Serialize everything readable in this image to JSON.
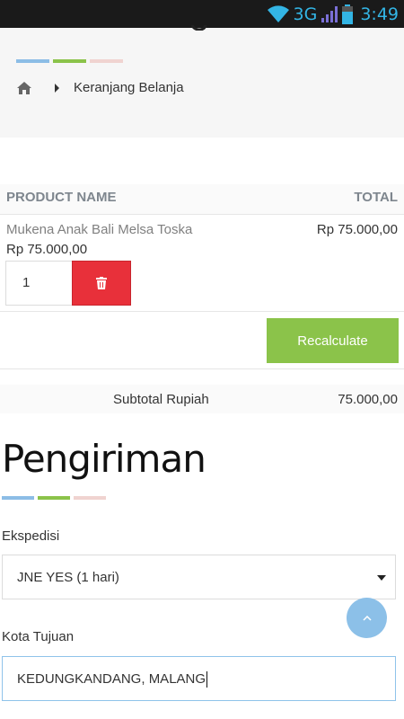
{
  "status_bar": {
    "network": "3G",
    "time": "3:49"
  },
  "breadcrumb": {
    "current": "Keranjang Belanja"
  },
  "cart": {
    "col_product": "PRODUCT NAME",
    "col_total": "TOTAL",
    "item": {
      "name": "Mukena Anak Bali Melsa Toska",
      "price": "Rp 75.000,00",
      "total": "Rp 75.000,00",
      "quantity": "1"
    },
    "recalculate_label": "Recalculate",
    "subtotal_label": "Subtotal Rupiah",
    "subtotal_value": "75.000,00"
  },
  "shipping": {
    "title": "Pengiriman",
    "courier_label": "Ekspedisi",
    "courier_value": "JNE YES (1 hari)",
    "city_label": "Kota Tujuan",
    "city_value": "KEDUNGKANDANG, MALANG"
  },
  "colors": {
    "accent_blue": "#8cbde6",
    "accent_green": "#8bc34a",
    "accent_pink": "#f0d3d0",
    "delete_red": "#e8303a",
    "status_blue": "#33b5e5"
  }
}
